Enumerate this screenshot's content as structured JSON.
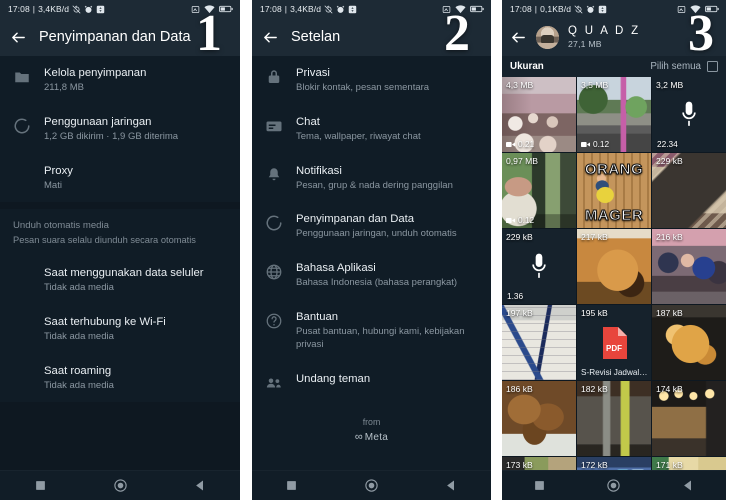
{
  "panels": [
    {
      "step": "1",
      "statusbar": {
        "time": "17:08",
        "data_rate": "3,4KB/d",
        "icons": [
          "sync-icon",
          "alarm-icon",
          "screenshot-icon",
          "sim-icon",
          "wifi-icon",
          "battery-icon"
        ]
      },
      "appbar": {
        "back": "back-arrow-icon",
        "title": "Penyimpanan dan Data"
      },
      "list": [
        {
          "icon": "folder-icon",
          "title": "Kelola penyimpanan",
          "subtitle": "211,8 MB"
        },
        {
          "icon": "sync-circle-icon",
          "title": "Penggunaan jaringan",
          "subtitle": "1,2 GB dikirim · 1,9 GB diterima"
        },
        {
          "icon": "",
          "title": "Proxy",
          "subtitle": "Mati"
        }
      ],
      "section": {
        "header": "Unduh otomatis media",
        "subheader": "Pesan suara selalu diunduh secara otomatis"
      },
      "section_items": [
        {
          "title": "Saat menggunakan data seluler",
          "subtitle": "Tidak ada media"
        },
        {
          "title": "Saat terhubung ke Wi-Fi",
          "subtitle": "Tidak ada media"
        },
        {
          "title": "Saat roaming",
          "subtitle": "Tidak ada media"
        }
      ]
    },
    {
      "step": "2",
      "statusbar": {
        "time": "17:08",
        "data_rate": "3,4KB/d",
        "icons": [
          "sync-icon",
          "alarm-icon",
          "screenshot-icon",
          "sim-icon",
          "wifi-icon",
          "battery-icon"
        ]
      },
      "appbar": {
        "back": "back-arrow-icon",
        "title": "Setelan"
      },
      "list": [
        {
          "icon": "lock-icon",
          "title": "Privasi",
          "subtitle": "Blokir kontak, pesan sementara"
        },
        {
          "icon": "chat-icon",
          "title": "Chat",
          "subtitle": "Tema, wallpaper, riwayat chat"
        },
        {
          "icon": "bell-icon",
          "title": "Notifikasi",
          "subtitle": "Pesan, grup & nada dering panggilan"
        },
        {
          "icon": "sync-circle-icon",
          "title": "Penyimpanan dan Data",
          "subtitle": "Penggunaan jaringan, unduh otomatis"
        },
        {
          "icon": "globe-icon",
          "title": "Bahasa Aplikasi",
          "subtitle": "Bahasa Indonesia (bahasa perangkat)"
        },
        {
          "icon": "help-icon",
          "title": "Bantuan",
          "subtitle": "Pusat bantuan, hubungi kami, kebijakan privasi"
        },
        {
          "icon": "people-icon",
          "title": "Undang teman",
          "subtitle": ""
        }
      ],
      "footer": {
        "from": "from",
        "brand": "Meta",
        "brand_mark": "∞"
      }
    },
    {
      "step": "3",
      "statusbar": {
        "time": "17:08",
        "data_rate": "0,1KB/d",
        "icons": [
          "sync-icon",
          "alarm-icon",
          "screenshot-icon",
          "sim-icon",
          "wifi-icon",
          "battery-icon"
        ]
      },
      "appbar": {
        "back": "back-arrow-icon",
        "avatar": "contact-avatar",
        "name": "Q U A D Z",
        "total_size": "27,1 MB"
      },
      "sizebar": {
        "label": "Ukuran",
        "select_all": "Pilih semua",
        "checkbox": "select-all-checkbox"
      },
      "tiles": [
        {
          "size": "4,3 MB",
          "duration": "0.21",
          "kind": "video",
          "art": "group-photo"
        },
        {
          "size": "3,5 MB",
          "duration": "0.12",
          "kind": "video",
          "art": "street-scene"
        },
        {
          "size": "3,2 MB",
          "duration": "22.34",
          "kind": "audio",
          "art": "audio"
        },
        {
          "size": "0,97 MB",
          "duration": "0.12",
          "kind": "video",
          "art": "woman-room"
        },
        {
          "size": "",
          "duration": "",
          "kind": "meme",
          "art": "meme",
          "line1": "ORANG",
          "line2": "MAGER"
        },
        {
          "size": "229 kB",
          "duration": "",
          "kind": "image",
          "art": "food-box"
        },
        {
          "size": "229 kB",
          "duration": "1.36",
          "kind": "audio",
          "art": "audio"
        },
        {
          "size": "217 kB",
          "duration": "",
          "kind": "image",
          "art": "fried-food"
        },
        {
          "size": "216 kB",
          "duration": "",
          "kind": "image",
          "art": "friends-selfie"
        },
        {
          "size": "197 kB",
          "duration": "",
          "kind": "image",
          "art": "notebook"
        },
        {
          "size": "195 kB",
          "duration": "",
          "kind": "document",
          "art": "pdf",
          "filename": "S-Revisi Jadwal Pe..."
        },
        {
          "size": "187 kB",
          "duration": "",
          "kind": "image",
          "art": "noodles"
        },
        {
          "size": "186 kB",
          "duration": "",
          "kind": "image",
          "art": "chicken"
        },
        {
          "size": "182 kB",
          "duration": "",
          "kind": "image",
          "art": "storefront"
        },
        {
          "size": "174 kB",
          "duration": "",
          "kind": "image",
          "art": "cafe-interior"
        },
        {
          "size": "173 kB",
          "duration": "",
          "kind": "image",
          "art": "crowd"
        },
        {
          "size": "172 kB",
          "duration": "",
          "kind": "image",
          "art": "night-blue"
        },
        {
          "size": "171 kB",
          "duration": "",
          "kind": "image",
          "art": "yellow-bag"
        }
      ]
    }
  ],
  "navbar": {
    "recent": "recent-apps-icon",
    "home": "home-icon",
    "back": "back-nav-icon"
  }
}
